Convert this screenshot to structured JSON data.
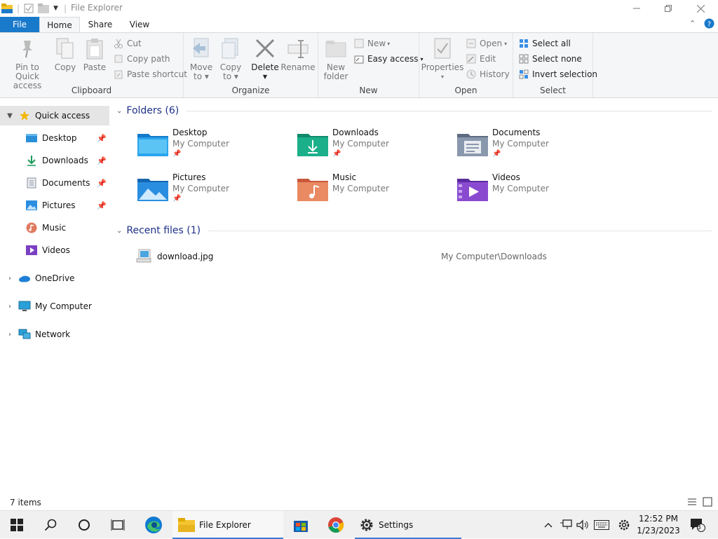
{
  "window": {
    "title": "File Explorer"
  },
  "tabs": [
    {
      "label": "File"
    },
    {
      "label": "Home"
    },
    {
      "label": "Share"
    },
    {
      "label": "View"
    }
  ],
  "ribbon": {
    "clipboard": {
      "label": "Clipboard",
      "pin_line1": "Pin to Quick",
      "pin_line2": "access",
      "copy": "Copy",
      "paste": "Paste",
      "cut": "Cut",
      "copy_path": "Copy path",
      "paste_shortcut": "Paste shortcut"
    },
    "organize": {
      "label": "Organize",
      "move_line1": "Move",
      "move_line2": "to",
      "copy_line1": "Copy",
      "copy_line2": "to",
      "delete": "Delete",
      "rename": "Rename"
    },
    "new": {
      "label": "New",
      "new_folder_line1": "New",
      "new_folder_line2": "folder",
      "new_item": "New",
      "easy_access": "Easy access"
    },
    "open": {
      "label": "Open",
      "properties": "Properties",
      "open": "Open",
      "edit": "Edit",
      "history": "History"
    },
    "select": {
      "label": "Select",
      "select_all": "Select all",
      "select_none": "Select none",
      "invert": "Invert selection"
    }
  },
  "nav": {
    "quick_access": "Quick access",
    "items": [
      {
        "label": "Desktop"
      },
      {
        "label": "Downloads"
      },
      {
        "label": "Documents"
      },
      {
        "label": "Pictures"
      },
      {
        "label": "Music"
      },
      {
        "label": "Videos"
      }
    ],
    "onedrive": "OneDrive",
    "my_computer": "My Computer",
    "network": "Network"
  },
  "content": {
    "folders_header": "Folders (6)",
    "folders": [
      {
        "name": "Desktop",
        "location": "My Computer"
      },
      {
        "name": "Downloads",
        "location": "My Computer"
      },
      {
        "name": "Documents",
        "location": "My Computer"
      },
      {
        "name": "Pictures",
        "location": "My Computer"
      },
      {
        "name": "Music",
        "location": "My Computer"
      },
      {
        "name": "Videos",
        "location": "My Computer"
      }
    ],
    "recent_header": "Recent files (1)",
    "recent": [
      {
        "name": "download.jpg",
        "path": "My Computer\\Downloads"
      }
    ]
  },
  "status": {
    "items_count": "7 items"
  },
  "taskbar": {
    "file_explorer": "File Explorer",
    "settings": "Settings",
    "time": "12:52 PM",
    "date": "1/23/2023",
    "notifications": "3"
  },
  "colors": {
    "accent": "#1979ca",
    "header_text": "#1e3287"
  }
}
